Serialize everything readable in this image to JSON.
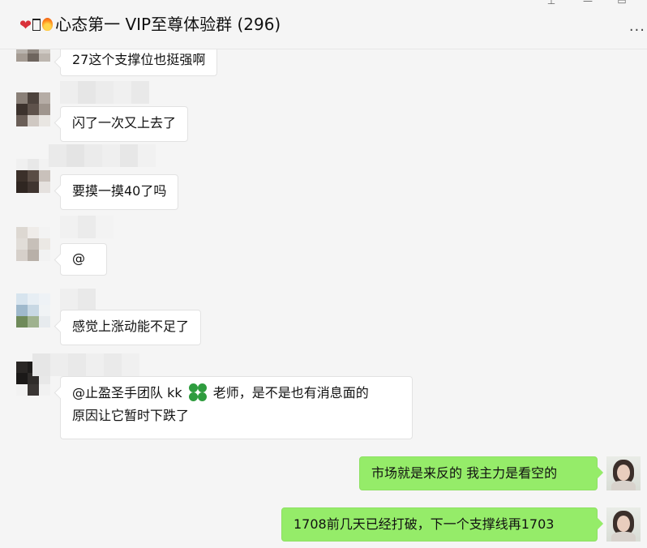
{
  "window": {
    "title_text": "心态第一 VIP至尊体验群 (296)",
    "minimize_icon": "minimize-icon",
    "maximize_icon": "maximize-icon",
    "close_icon": "close-icon",
    "more_icon": "more-icon"
  },
  "messages": [
    {
      "text": "27这个支撑位也挺强啊",
      "side": "in"
    },
    {
      "text": "闪了一次又上去了",
      "side": "in"
    },
    {
      "text": "要摸一摸40了吗",
      "side": "in"
    },
    {
      "text": "@",
      "side": "in"
    },
    {
      "text": "感觉上涨动能不足了",
      "side": "in"
    },
    {
      "line1_pre": "@止盈圣手团队 kk",
      "line1_post": " 老师，是不是也有消息面的",
      "line2": "原因让它暂时下跌了",
      "side": "in",
      "emoji": "four-leaf-clover-emoji"
    },
    {
      "text": "市场就是来反的 我主力是看空的",
      "side": "out"
    },
    {
      "text": "1708前几天已经打破，下一个支撑线再1703",
      "side": "out"
    }
  ],
  "colors": {
    "background": "#f5f5f5",
    "incoming_bubble": "#ffffff",
    "outgoing_bubble": "#95ec69"
  }
}
